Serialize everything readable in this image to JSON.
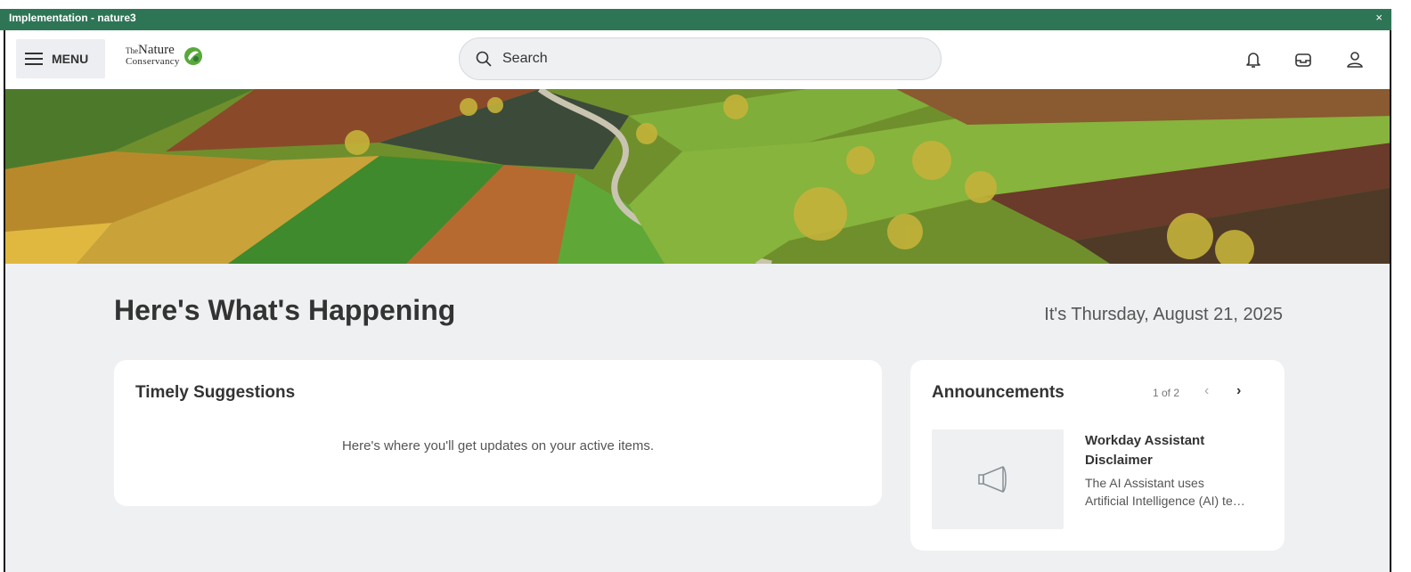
{
  "window": {
    "env_title": "Implementation - nature3",
    "close_glyph": "×"
  },
  "header": {
    "menu_label": "MENU",
    "logo": {
      "line1_prefix": "The",
      "line1": "Nature",
      "line2": "Conservancy"
    },
    "search_placeholder": "Search",
    "icons": [
      "bell-icon",
      "inbox-icon",
      "profile-icon"
    ]
  },
  "main": {
    "title": "Here's What's Happening",
    "date": "It's Thursday, August 21, 2025",
    "timely": {
      "title": "Timely Suggestions",
      "message": "Here's where you'll get updates on your active items."
    },
    "announcements": {
      "title": "Announcements",
      "pager": "1 of 2",
      "prev_glyph": "‹",
      "next_glyph": "›",
      "item_title": "Workday Assistant Disclaimer",
      "item_body_line1": "The AI Assistant uses",
      "item_body_line2": "Artificial Intelligence (AI) te…"
    }
  },
  "colors": {
    "env_bar": "#2e7556",
    "background": "#eef0f2",
    "card": "#ffffff"
  }
}
